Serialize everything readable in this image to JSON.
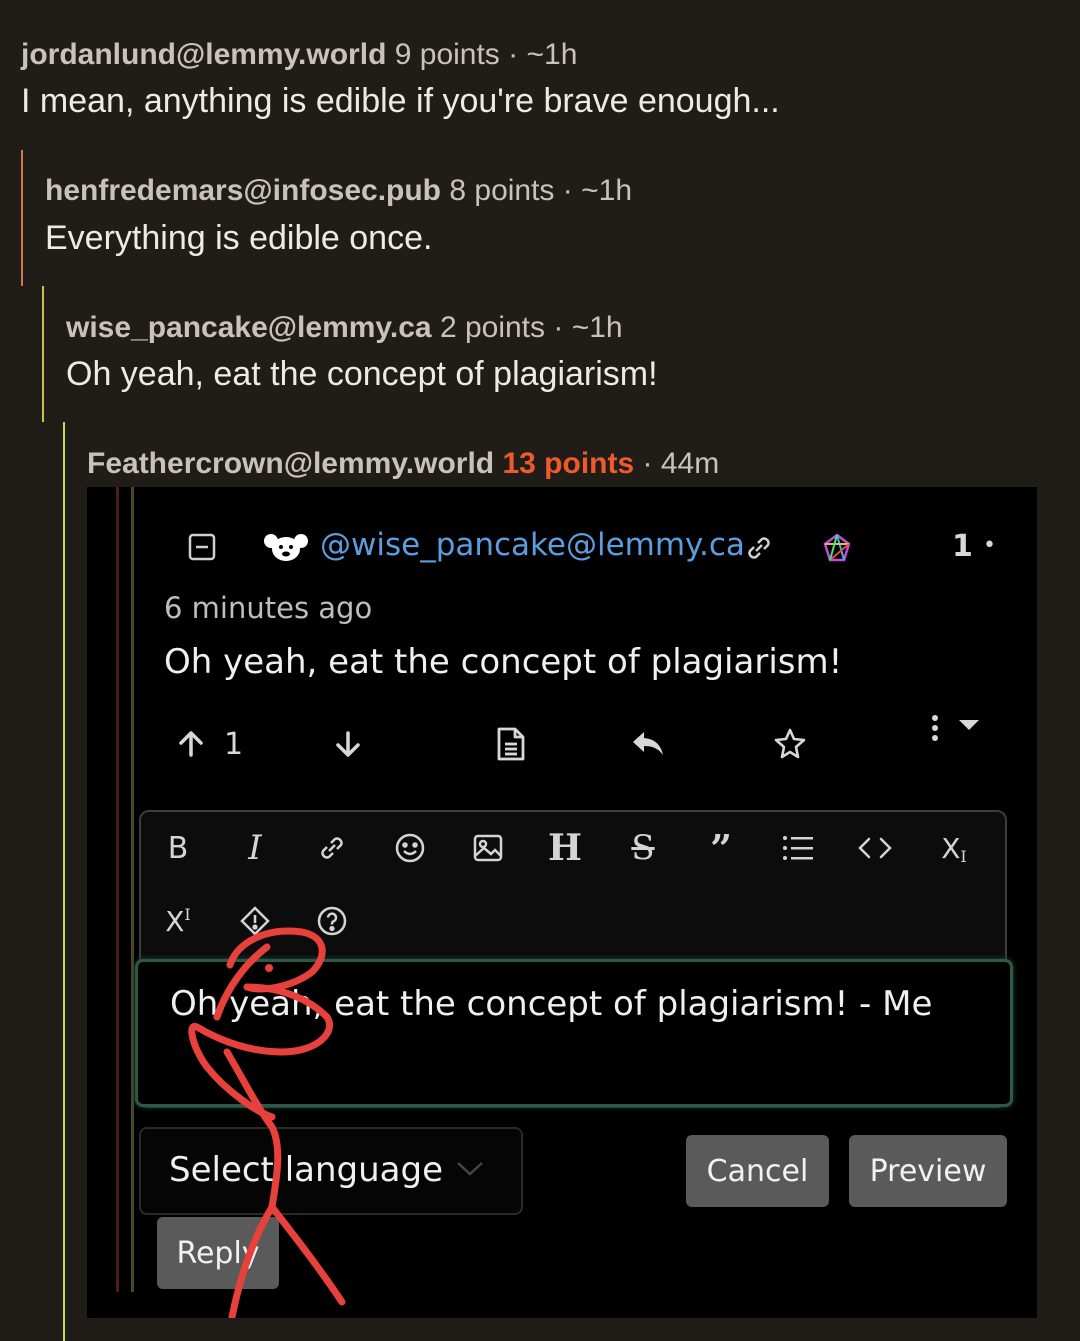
{
  "comments": [
    {
      "author": "jordanlund@lemmy.world",
      "points": "9 points",
      "age": "~1h",
      "text": "I mean, anything is edible if you're brave enough..."
    },
    {
      "author": "henfredemars@infosec.pub",
      "points": "8 points",
      "age": "~1h",
      "text": "Everything is edible once."
    },
    {
      "author": "wise_pancake@lemmy.ca",
      "points": "2 points",
      "age": "~1h",
      "text": "Oh yeah, eat the concept of plagiarism!"
    },
    {
      "author": "Feathercrown@lemmy.world",
      "points": "13 points",
      "age": "44m"
    }
  ],
  "separator": "·",
  "colors": {
    "background": "#201d18",
    "hot_points": "#ef5a2c",
    "link": "#5b9ee0",
    "thread_1": "#c97b4a",
    "thread_2": "#c9c23a",
    "thread_3": "#b7e06a"
  },
  "screenshot": {
    "user": "@wise_pancake@lemmy.ca",
    "score": "1",
    "time": "6 minutes ago",
    "comment": "Oh yeah, eat the concept of plagiarism!",
    "upvotes": "1",
    "toolbar": [
      "bold-icon",
      "italic-icon",
      "link-icon",
      "emoji-icon",
      "image-icon",
      "header-icon",
      "strikethrough-icon",
      "quote-icon",
      "list-icon",
      "code-icon",
      "subscript-icon",
      "superscript-icon",
      "spoiler-icon",
      "help-icon"
    ],
    "reply_text": "Oh yeah, eat the concept of plagiarism! - Me",
    "language_placeholder": "Select language",
    "cancel": "Cancel",
    "preview": "Preview",
    "reply": "Reply"
  }
}
